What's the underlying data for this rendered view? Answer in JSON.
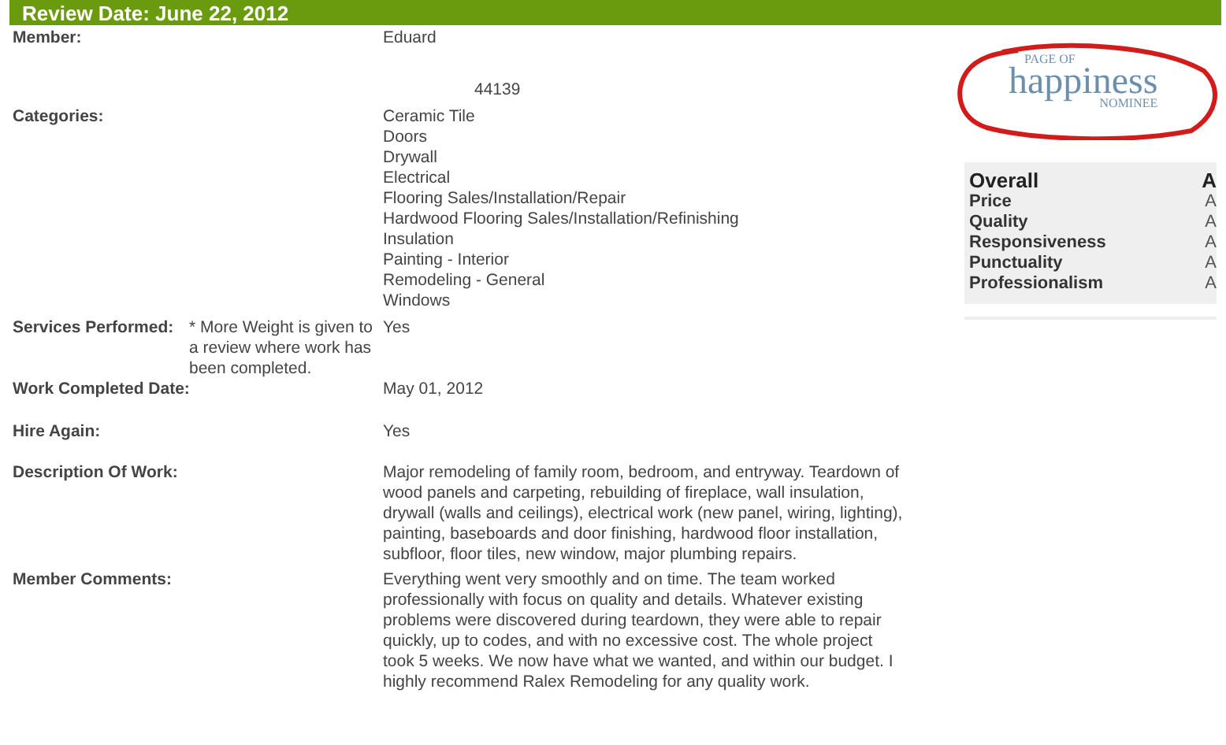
{
  "header": {
    "title": "Review Date: June 22, 2012"
  },
  "member": {
    "label": "Member:",
    "name": "Eduard",
    "zip": "44139"
  },
  "categories": {
    "label": "Categories:",
    "items": [
      "Ceramic Tile",
      "Doors",
      "Drywall",
      "Electrical",
      "Flooring Sales/Installation/Repair",
      "Hardwood Flooring Sales/Installation/Refinishing",
      "Insulation",
      "Painting - Interior",
      "Remodeling - General",
      "Windows"
    ]
  },
  "services": {
    "label": "Services Performed:",
    "note": "* More Weight is given to a review where work has been completed.",
    "value": "Yes"
  },
  "fields": [
    {
      "label": "Work Completed Date:",
      "value": "May 01, 2012"
    },
    {
      "label": "Hire Again:",
      "value": "Yes"
    },
    {
      "label": "Description Of Work:",
      "value": "Major remodeling of family room, bedroom, and entryway. Teardown of wood panels and carpeting, rebuilding of fireplace, wall insulation, drywall (walls and ceilings), electrical work (new panel, wiring, lighting), painting, baseboards and door finishing, hardwood floor installation, subfloor, floor tiles, new window, major plumbing repairs."
    },
    {
      "label": "Member Comments:",
      "value": "Everything went very smoothly and on time. The team worked professionally with focus on quality and details. Whatever existing problems were discovered during teardown, they were able to repair quickly, up to codes, and with no excessive cost. The whole project took 5 weeks. We now have what we wanted, and within our budget. I highly recommend Ralex Remodeling for any quality work."
    }
  ],
  "badge": {
    "top": "PAGE OF",
    "main": "happiness",
    "bottom": "NOMINEE"
  },
  "ratings": [
    {
      "kind": "overall",
      "name": "Overall",
      "grade": "A"
    },
    {
      "kind": "item",
      "name": "Price",
      "grade": "A"
    },
    {
      "kind": "item",
      "name": "Quality",
      "grade": "A"
    },
    {
      "kind": "item",
      "name": "Responsiveness",
      "grade": "A"
    },
    {
      "kind": "item",
      "name": "Punctuality",
      "grade": "A"
    },
    {
      "kind": "item",
      "name": "Professionalism",
      "grade": "A"
    }
  ]
}
